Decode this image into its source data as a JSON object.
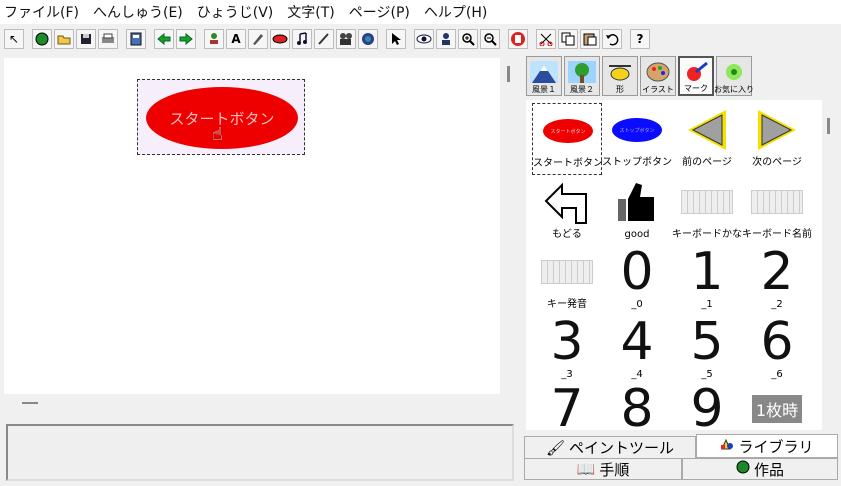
{
  "menu": [
    "ファイル(F)",
    "へんしゅう(E)",
    "ひょうじ(V)",
    "文字(T)",
    "ページ(P)",
    "ヘルプ(H)"
  ],
  "toolbar": [
    "cursor-arrow-icon",
    "globe-icon",
    "open-folder-icon",
    "save-icon",
    "print-icon",
    "page-layout-icon",
    "arrow-left-icon",
    "arrow-right-icon",
    "stamp-icon",
    "text-a-icon",
    "paint-icon",
    "button-icon",
    "music-icon",
    "pen-icon",
    "movie-icon",
    "record-icon",
    "select-arrow-icon",
    "eye-icon",
    "person-icon",
    "zoom-in-icon",
    "zoom-out-icon",
    "stop-hand-icon",
    "cut-icon",
    "copy-icon",
    "paste-icon",
    "undo-icon",
    "help-icon"
  ],
  "canvas": {
    "object_label": "スタートボタン"
  },
  "palette": {
    "tabs": [
      {
        "label": "風景１",
        "icon": "mountain-icon"
      },
      {
        "label": "風景２",
        "icon": "tree-icon"
      },
      {
        "label": "形",
        "icon": "helicopter-icon"
      },
      {
        "label": "イラスト",
        "icon": "palette-icon"
      },
      {
        "label": "マーク",
        "icon": "mark-icon"
      },
      {
        "label": "お気に入り",
        "icon": "flower-icon"
      }
    ],
    "items": [
      {
        "label": "スタートボタン",
        "thumb": "スタートボタン"
      },
      {
        "label": "ストップボタン",
        "thumb": "ストップボタン"
      },
      {
        "label": "前のページ"
      },
      {
        "label": "次のページ"
      },
      {
        "label": "もどる"
      },
      {
        "label": "good"
      },
      {
        "label": "キーボードかな"
      },
      {
        "label": "キーボード名前"
      },
      {
        "label": "キー発音"
      },
      {
        "label": "_0",
        "digit": "0"
      },
      {
        "label": "_1",
        "digit": "1"
      },
      {
        "label": "_2",
        "digit": "2"
      },
      {
        "label": "_3",
        "digit": "3"
      },
      {
        "label": "_4",
        "digit": "4"
      },
      {
        "label": "_5",
        "digit": "5"
      },
      {
        "label": "_6",
        "digit": "6"
      },
      {
        "label": "",
        "digit": "7"
      },
      {
        "label": "",
        "digit": "8"
      },
      {
        "label": "",
        "digit": "9"
      },
      {
        "label": "",
        "thumb": "1枚時"
      }
    ]
  },
  "bottom_tabs": {
    "paint_tool": "ペイントツール",
    "library": "ライブラリ",
    "steps": "手順",
    "works": "作品"
  }
}
